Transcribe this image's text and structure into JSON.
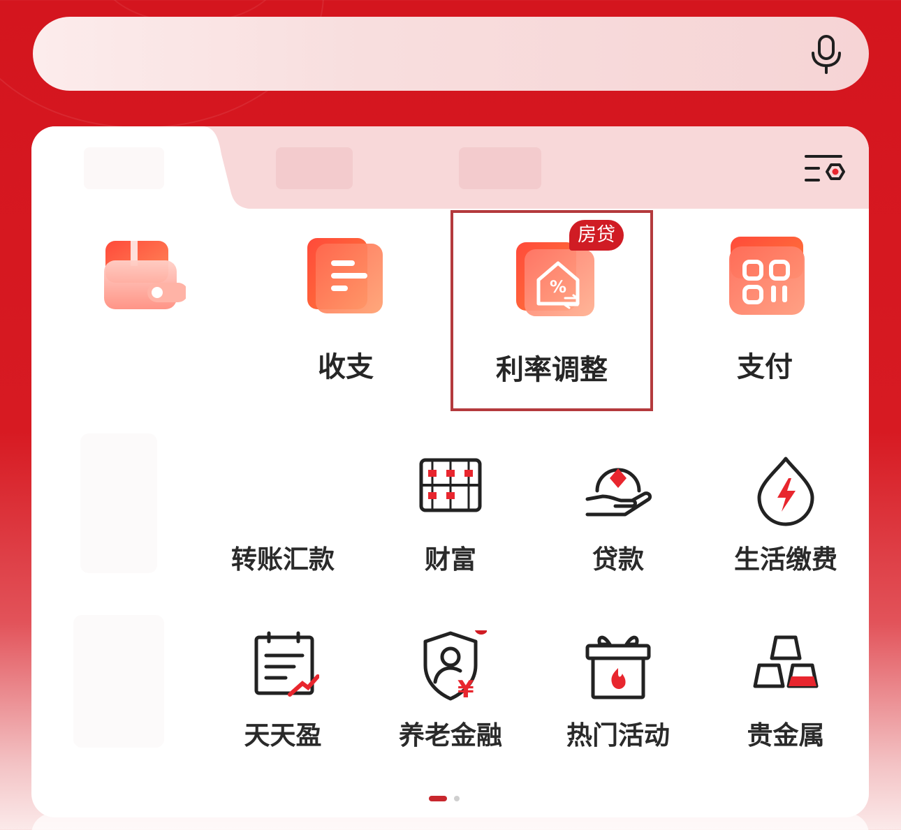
{
  "search": {
    "placeholder": ""
  },
  "tabs": [
    {
      "label": ""
    },
    {
      "label": ""
    },
    {
      "label": ""
    }
  ],
  "features": [
    {
      "label": ""
    },
    {
      "label": "收支"
    },
    {
      "label": "利率调整",
      "badge": "房贷"
    },
    {
      "label": "支付"
    }
  ],
  "grid": [
    {
      "label": "转账汇款"
    },
    {
      "label": "财富"
    },
    {
      "label": "贷款"
    },
    {
      "label": "生活缴费"
    },
    {
      "label": "天天盈"
    },
    {
      "label": "养老金融"
    },
    {
      "label": "热门活动"
    },
    {
      "label": "贵金属"
    }
  ],
  "colors": {
    "brand": "#d4151e",
    "highlight_border": "#b43a3d",
    "text": "#262626"
  },
  "pagination": {
    "total": 2,
    "current": 1
  }
}
